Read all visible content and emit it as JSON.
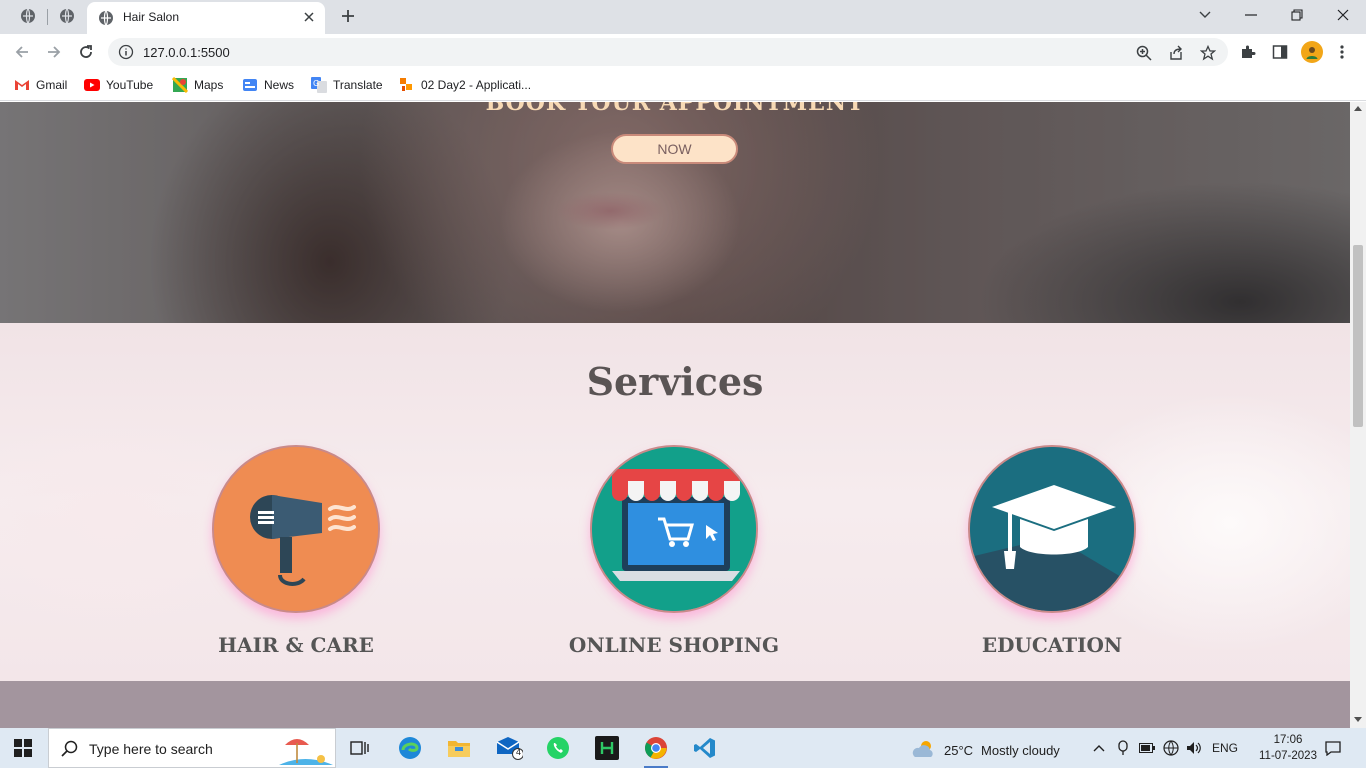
{
  "browser": {
    "tab_title": "Hair Salon",
    "url": "127.0.0.1:5500",
    "bookmarks": [
      {
        "label": "Gmail",
        "icon": "gmail-icon"
      },
      {
        "label": "YouTube",
        "icon": "youtube-icon"
      },
      {
        "label": "Maps",
        "icon": "maps-icon"
      },
      {
        "label": "News",
        "icon": "news-icon"
      },
      {
        "label": "Translate",
        "icon": "translate-icon"
      },
      {
        "label": "02 Day2 - Applicati...",
        "icon": "app-icon"
      }
    ]
  },
  "page": {
    "hero": {
      "heading": "BOOK YOUR APPOINTMENT",
      "button": "NOW"
    },
    "services": {
      "title": "Services",
      "items": [
        {
          "label": "HAIR & CARE",
          "icon": "hair-dryer-icon",
          "color": "#ef8c52"
        },
        {
          "label": "ONLINE SHOPING",
          "icon": "online-shop-icon",
          "color": "#12a08a"
        },
        {
          "label": "EDUCATION",
          "icon": "graduation-cap-icon",
          "color": "#1b6e80"
        }
      ]
    }
  },
  "taskbar": {
    "search_placeholder": "Type here to search",
    "mail_badge": "4",
    "weather_temp": "25°C",
    "weather_text": "Mostly cloudy",
    "language": "ENG",
    "time": "17:06",
    "date": "11-07-2023"
  },
  "colors": {
    "tabstrip": "#dee1e6",
    "taskbar": "#dfe9f3",
    "footer_band": "#a3959e",
    "hero_heading": "#f7d9b4",
    "now_button": "#fde3c8"
  }
}
